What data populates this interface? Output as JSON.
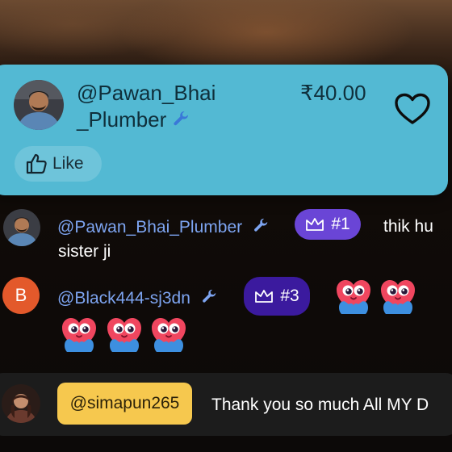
{
  "super_chat": {
    "username_line1": "@Pawan_Bhai",
    "username_line2": "_Plumber",
    "amount": "₹40.00",
    "like_label": "Like",
    "card_color": "#53b9d3"
  },
  "messages": [
    {
      "username": "@Pawan_Bhai_Plumber",
      "rank": "#1",
      "rank_color": "#6a45d6",
      "text_line1": "thik hu",
      "text_line2": "sister ji",
      "avatar": "photo"
    },
    {
      "username": "@Black444-sj3dn",
      "rank": "#3",
      "rank_color": "#3b1a9e",
      "avatar_letter": "B",
      "avatar_color": "#e3592b",
      "emoji": "heart-hands-emoji",
      "emoji_count": 5
    }
  ],
  "pinned": {
    "mention": "@simapun265",
    "text": "Thank you so much All MY D",
    "mention_color": "#f6c84e"
  },
  "icons": [
    "wrench-icon",
    "crown-icon",
    "heart-outline-icon",
    "thumbs-up-icon"
  ]
}
